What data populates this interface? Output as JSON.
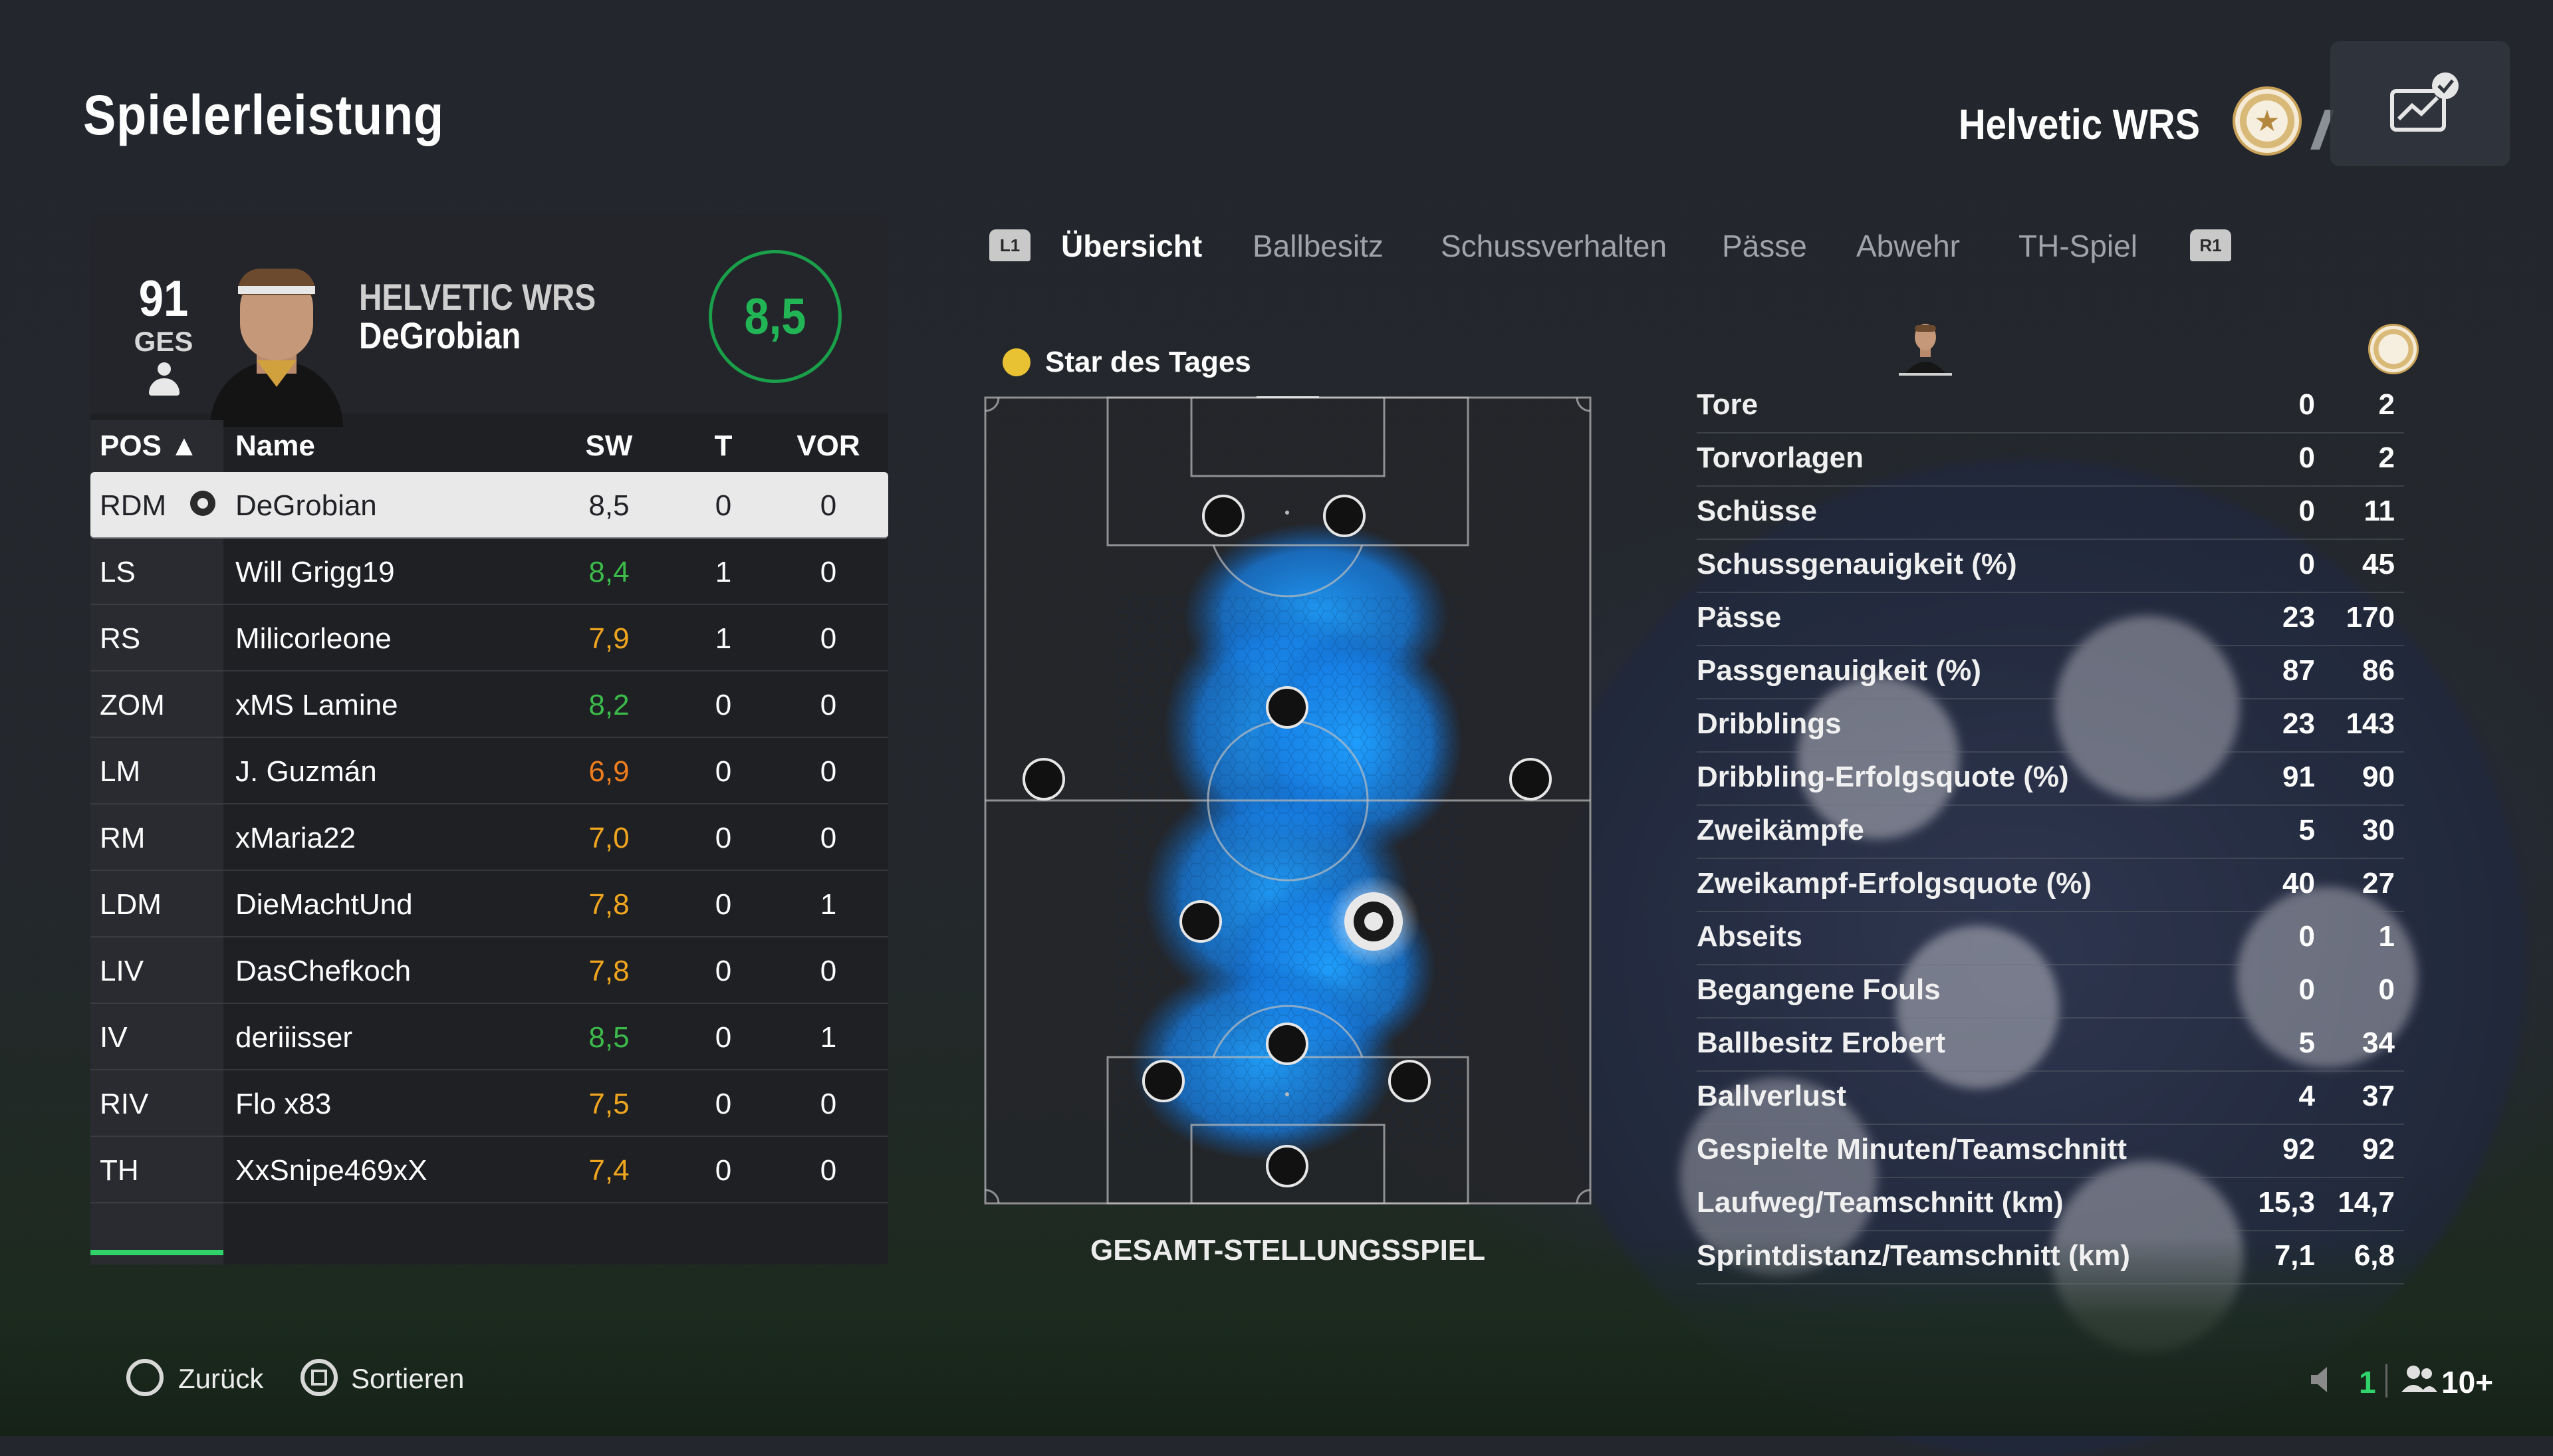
{
  "page": {
    "title": "Spielerleistung"
  },
  "header": {
    "team_name": "Helvetic WRS"
  },
  "player_card": {
    "overall": "91",
    "overall_label": "GES",
    "club": "HELVETIC WRS",
    "name": "DeGrobian",
    "rating": "8,5",
    "rating_color": "#22b555"
  },
  "table": {
    "columns": {
      "pos": "POS ▲",
      "name": "Name",
      "sw": "SW",
      "t": "T",
      "vor": "VOR"
    },
    "rows": [
      {
        "pos": "RDM",
        "name": "DeGrobian",
        "sw": "8,5",
        "t": "0",
        "vor": "0",
        "sw_color": "#202226"
      },
      {
        "pos": "LS",
        "name": "Will Grigg19",
        "sw": "8,4",
        "t": "1",
        "vor": "0",
        "sw_color": "#3cba4a"
      },
      {
        "pos": "RS",
        "name": "Milicorleone",
        "sw": "7,9",
        "t": "1",
        "vor": "0",
        "sw_color": "#f0a51e"
      },
      {
        "pos": "ZOM",
        "name": "xMS Lamine",
        "sw": "8,2",
        "t": "0",
        "vor": "0",
        "sw_color": "#3cba4a"
      },
      {
        "pos": "LM",
        "name": "J. Guzmán",
        "sw": "6,9",
        "t": "0",
        "vor": "0",
        "sw_color": "#f07d1e"
      },
      {
        "pos": "RM",
        "name": "xMaria22",
        "sw": "7,0",
        "t": "0",
        "vor": "0",
        "sw_color": "#f0a51e"
      },
      {
        "pos": "LDM",
        "name": "DieMachtUnd",
        "sw": "7,8",
        "t": "0",
        "vor": "1",
        "sw_color": "#f0a51e"
      },
      {
        "pos": "LIV",
        "name": "DasChefkoch",
        "sw": "7,8",
        "t": "0",
        "vor": "0",
        "sw_color": "#f0a51e"
      },
      {
        "pos": "IV",
        "name": "deriiisser",
        "sw": "8,5",
        "t": "0",
        "vor": "1",
        "sw_color": "#3cba4a"
      },
      {
        "pos": "RIV",
        "name": "Flo x83",
        "sw": "7,5",
        "t": "0",
        "vor": "0",
        "sw_color": "#f0a51e"
      },
      {
        "pos": "TH",
        "name": "XxSnipe469xX",
        "sw": "7,4",
        "t": "0",
        "vor": "0",
        "sw_color": "#f0a51e"
      }
    ]
  },
  "tabs": {
    "left_bumper": "L1",
    "right_bumper": "R1",
    "items": [
      "Übersicht",
      "Ballbesitz",
      "Schussverhalten",
      "Pässe",
      "Abwehr",
      "TH-Spiel"
    ],
    "active_index": 0
  },
  "pitch": {
    "star_label": "Star des Tages",
    "caption": "GESAMT-STELLUNGSSPIEL",
    "heatmap_color": "#1e90ff"
  },
  "stats": {
    "rows": [
      {
        "label": "Tore",
        "player": "0",
        "team": "2"
      },
      {
        "label": "Torvorlagen",
        "player": "0",
        "team": "2"
      },
      {
        "label": "Schüsse",
        "player": "0",
        "team": "11"
      },
      {
        "label": "Schussgenauigkeit (%)",
        "player": "0",
        "team": "45"
      },
      {
        "label": "Pässe",
        "player": "23",
        "team": "170"
      },
      {
        "label": "Passgenauigkeit (%)",
        "player": "87",
        "team": "86"
      },
      {
        "label": "Dribblings",
        "player": "23",
        "team": "143"
      },
      {
        "label": "Dribbling-Erfolgsquote (%)",
        "player": "91",
        "team": "90"
      },
      {
        "label": "Zweikämpfe",
        "player": "5",
        "team": "30"
      },
      {
        "label": "Zweikampf-Erfolgsquote (%)",
        "player": "40",
        "team": "27"
      },
      {
        "label": "Abseits",
        "player": "0",
        "team": "1"
      },
      {
        "label": "Begangene Fouls",
        "player": "0",
        "team": "0"
      },
      {
        "label": "Ballbesitz Erobert",
        "player": "5",
        "team": "34"
      },
      {
        "label": "Ballverlust",
        "player": "4",
        "team": "37"
      },
      {
        "label": "Gespielte Minuten/Teamschnitt",
        "player": "92",
        "team": "92"
      },
      {
        "label": "Laufweg/Teamschnitt (km)",
        "player": "15,3",
        "team": "14,7"
      },
      {
        "label": "Sprintdistanz/Teamschnitt (km)",
        "player": "7,1",
        "team": "6,8"
      }
    ]
  },
  "footer": {
    "back_label": "Zurück",
    "sort_label": "Sortieren",
    "voice_count": "1",
    "players_count": "10+"
  }
}
